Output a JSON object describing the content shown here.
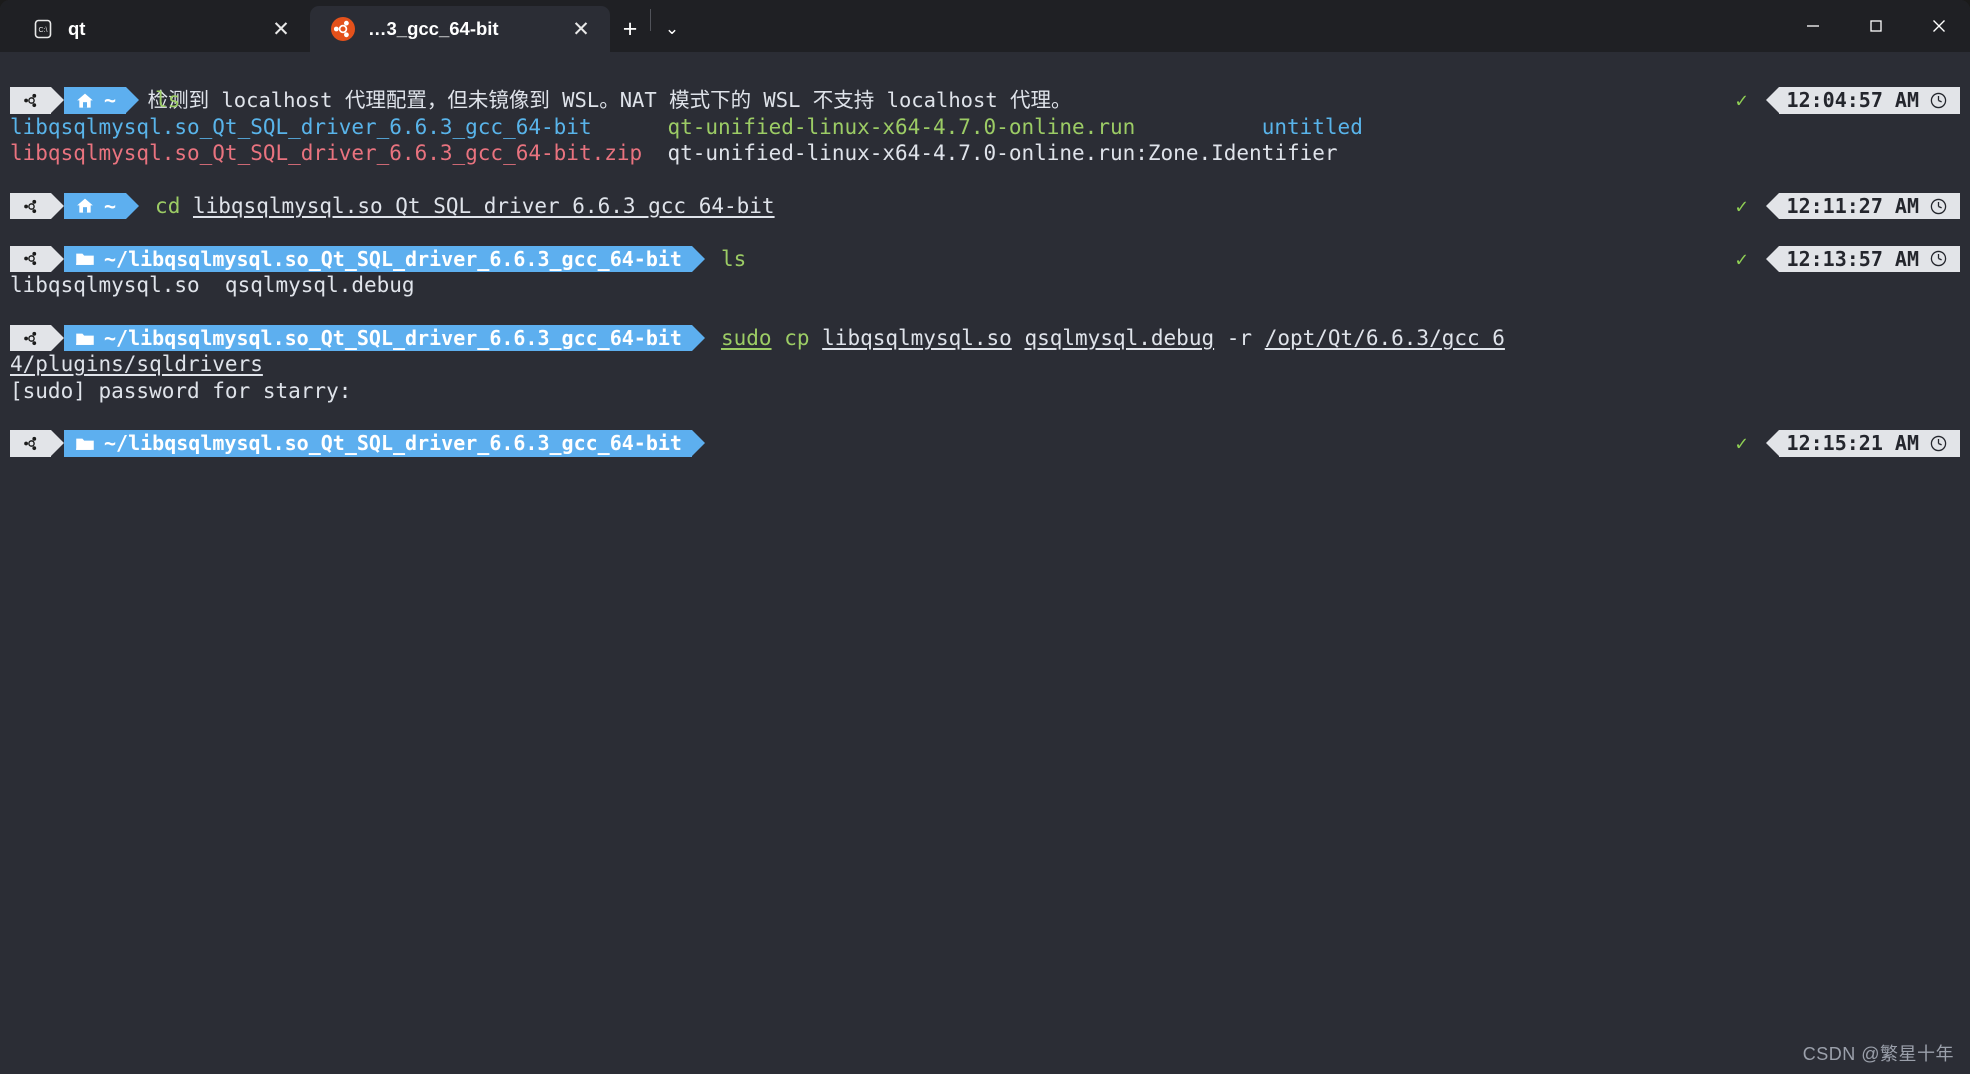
{
  "window": {
    "controls": {
      "minimize": "minimize-icon",
      "maximize": "maximize-icon",
      "close": "close-icon"
    }
  },
  "tabs": [
    {
      "title": "qt",
      "icon": "cmd-console-icon",
      "active": false,
      "close_label": "✕"
    },
    {
      "title": "…3_gcc_64-bit",
      "icon": "ubuntu-icon",
      "active": true,
      "close_label": "✕"
    }
  ],
  "tabbar": {
    "new_tab_label": "+",
    "dropdown_label": "⌄"
  },
  "terminal": {
    "wsl_notice": "wsl: 检测到 localhost 代理配置，但未镜像到 WSL。NAT 模式下的 WSL 不支持 localhost 代理。",
    "clock_icon": "clock-icon",
    "ok_mark": "✓",
    "blocks": [
      {
        "prompt": {
          "os_icon": "ubuntu-icon",
          "path_icon": "home-icon",
          "path": "~"
        },
        "command": [
          {
            "text": "ls",
            "color": "green",
            "underline": false
          }
        ],
        "status": {
          "exit_ok": true,
          "time": "12:04:57 AM"
        },
        "output": [
          [
            {
              "text": "libqsqlmysql.so_Qt_SQL_driver_6.6.3_gcc_64-bit",
              "color": "blue"
            },
            {
              "text": "      ",
              "color": "white"
            },
            {
              "text": "qt-unified-linux-x64-4.7.0-online.run",
              "color": "green"
            },
            {
              "text": "          ",
              "color": "white"
            },
            {
              "text": "untitled",
              "color": "blue"
            }
          ],
          [
            {
              "text": "libqsqlmysql.so_Qt_SQL_driver_6.6.3_gcc_64-bit.zip",
              "color": "red"
            },
            {
              "text": "  ",
              "color": "white"
            },
            {
              "text": "qt-unified-linux-x64-4.7.0-online.run:Zone.Identifier",
              "color": "white"
            }
          ]
        ]
      },
      {
        "prompt": {
          "os_icon": "ubuntu-icon",
          "path_icon": "home-icon",
          "path": "~"
        },
        "command": [
          {
            "text": "cd ",
            "color": "green",
            "underline": false
          },
          {
            "text": "libqsqlmysql.so_Qt_SQL_driver_6.6.3_gcc_64-bit",
            "color": "white",
            "underline": true
          }
        ],
        "status": {
          "exit_ok": true,
          "time": "12:11:27 AM"
        },
        "output": []
      },
      {
        "prompt": {
          "os_icon": "ubuntu-icon",
          "path_icon": "folder-icon",
          "path": "~/libqsqlmysql.so_Qt_SQL_driver_6.6.3_gcc_64-bit"
        },
        "command": [
          {
            "text": "ls",
            "color": "green",
            "underline": false
          }
        ],
        "status": {
          "exit_ok": true,
          "time": "12:13:57 AM"
        },
        "output": [
          [
            {
              "text": "libqsqlmysql.so  qsqlmysql.debug",
              "color": "white"
            }
          ]
        ]
      },
      {
        "prompt": {
          "os_icon": "ubuntu-icon",
          "path_icon": "folder-icon",
          "path": "~/libqsqlmysql.so_Qt_SQL_driver_6.6.3_gcc_64-bit"
        },
        "command": [
          {
            "text": "sudo",
            "color": "green",
            "underline": true
          },
          {
            "text": " ",
            "color": "white",
            "underline": false
          },
          {
            "text": "cp",
            "color": "green",
            "underline": false
          },
          {
            "text": " ",
            "color": "white",
            "underline": false
          },
          {
            "text": "libqsqlmysql.so",
            "color": "white",
            "underline": true
          },
          {
            "text": " ",
            "color": "white",
            "underline": false
          },
          {
            "text": "qsqlmysql.debug",
            "color": "white",
            "underline": true
          },
          {
            "text": " -r ",
            "color": "white",
            "underline": false
          },
          {
            "text": "/opt/Qt/6.6.3/gcc_6",
            "color": "white",
            "underline": true
          }
        ],
        "status": null,
        "output": [
          [
            {
              "text": "4/plugins/sqldrivers",
              "color": "white",
              "underline": true
            }
          ],
          [
            {
              "text": "[sudo] password for starry:",
              "color": "white"
            }
          ]
        ]
      },
      {
        "prompt": {
          "os_icon": "ubuntu-icon",
          "path_icon": "folder-icon",
          "path": "~/libqsqlmysql.so_Qt_SQL_driver_6.6.3_gcc_64-bit"
        },
        "command": [],
        "status": {
          "exit_ok": true,
          "time": "12:15:21 AM"
        },
        "output": []
      }
    ]
  },
  "watermark": "CSDN @繁星十年",
  "colors": {
    "background": "#2b2d35",
    "tabbar": "#1f2024",
    "prompt_blue": "#5dafef",
    "prompt_light": "#e2e4e8",
    "green": "#9ccc65",
    "blue": "#59b4ea",
    "red": "#e9737f",
    "white": "#dfe3ea",
    "ok_green": "#8fcf54"
  }
}
